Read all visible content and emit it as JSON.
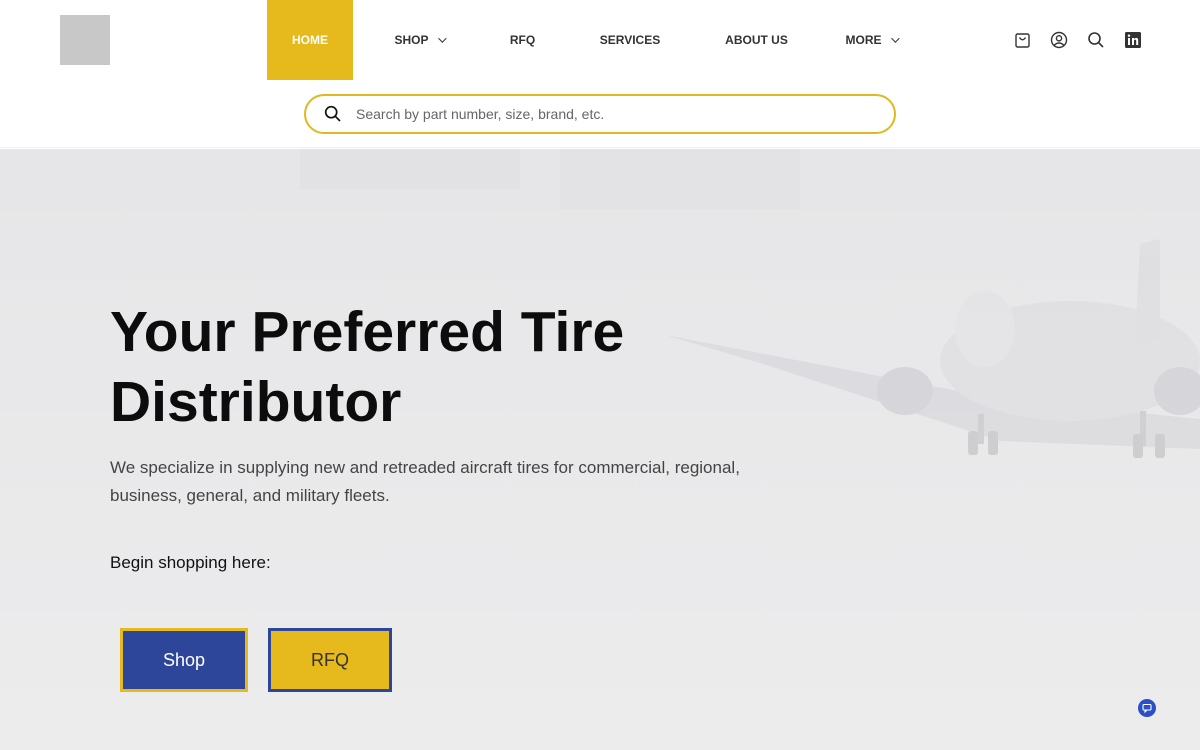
{
  "nav": {
    "items": [
      {
        "label": "HOME",
        "active": true
      },
      {
        "label": "SHOP",
        "has_dropdown": true
      },
      {
        "label": "RFQ"
      },
      {
        "label": "SERVICES"
      },
      {
        "label": "ABOUT US"
      },
      {
        "label": "MORE",
        "has_dropdown": true
      }
    ]
  },
  "header_icons": [
    "shopping-bag-icon",
    "user-account-icon",
    "search-icon",
    "linkedin-icon"
  ],
  "search": {
    "placeholder": "Search by part number, size, brand, etc.",
    "value": ""
  },
  "hero": {
    "title_line1": "Your Preferred Tire",
    "title_line2": "Distributor",
    "description": "We specialize in supplying new and retreaded aircraft tires for commercial, regional, business, general, and military fleets.",
    "cta_label": "Begin shopping here:",
    "buttons": {
      "shop": "Shop",
      "rfq": "RFQ"
    }
  },
  "colors": {
    "accent_yellow": "#e6b91c",
    "brand_blue": "#2e4699",
    "chat_blue": "#2b4fc4",
    "hero_bg": "#e9e9ea"
  }
}
